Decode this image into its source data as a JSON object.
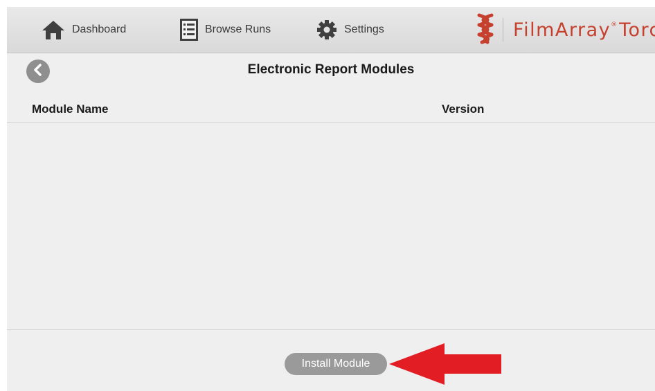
{
  "nav": {
    "dashboard_label": "Dashboard",
    "browse_label": "Browse Runs",
    "settings_label": "Settings",
    "icons": [
      "home-icon",
      "list-icon",
      "gear-icon"
    ]
  },
  "brand": {
    "name": "FilmArray",
    "mark": "®",
    "product": "Torch",
    "logo_icon": "helix-logo",
    "color": "#c6402e"
  },
  "page": {
    "title": "Electronic Report Modules",
    "back_icon": "chevron-left-icon"
  },
  "table": {
    "columns": [
      "Module Name",
      "Version"
    ],
    "rows": []
  },
  "footer": {
    "install_label": "Install Module"
  },
  "annotation": {
    "arrow_color": "#e21d24"
  }
}
